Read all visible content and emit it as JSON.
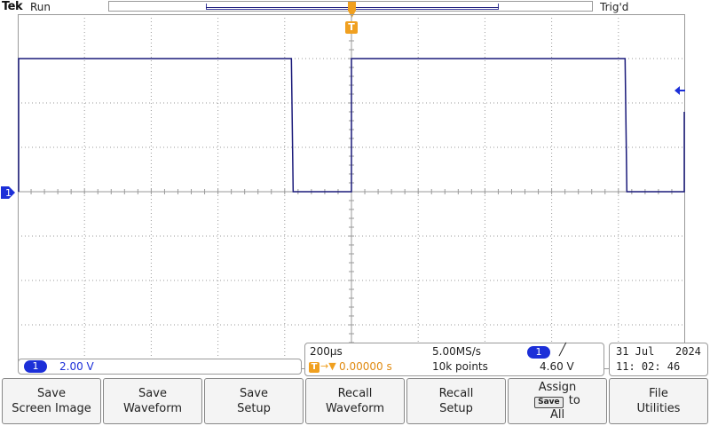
{
  "header": {
    "brand": "Tek",
    "run_state": "Run",
    "trigger_status": "Trig'd"
  },
  "markers": {
    "trigger_position_label": "T",
    "ch1_ground_label": "1"
  },
  "channel1": {
    "number": "1",
    "scale": "2.00 V",
    "color": "#1c2fd8"
  },
  "horizontal": {
    "timebase": "200μs",
    "sample_rate": "5.00MS/s",
    "trigger_source": "1",
    "trigger_slope": "╱",
    "delay_T": "T",
    "delay_arrow": "→▼",
    "delay": "0.00000 s",
    "record_length": "10k points",
    "trigger_level": "4.60 V"
  },
  "datetime": {
    "day_month": "31 Jul",
    "year": "2024",
    "time": "11: 02: 46"
  },
  "softkeys": {
    "save_screen_image": {
      "line1": "Save",
      "line2": "Screen Image"
    },
    "save_waveform": {
      "line1": "Save",
      "line2": "Waveform"
    },
    "save_setup": {
      "line1": "Save",
      "line2": "Setup"
    },
    "recall_waveform": {
      "line1": "Recall",
      "line2": "Waveform"
    },
    "recall_setup": {
      "line1": "Recall",
      "line2": "Setup"
    },
    "assign_save": {
      "line1": "Assign",
      "badge": "Save",
      "line2b": "to",
      "line3": "All"
    },
    "file_utilities": {
      "line1": "File",
      "line2": "Utilities"
    }
  },
  "colors": {
    "trace": "#1a1a7a",
    "trigger_marker": "#f0a020",
    "graticule": "#9a9a9a"
  },
  "waveform": {
    "type": "square",
    "high_divisions": 3.0,
    "low_divisions": 0.0,
    "pulse_edges_divisions": [
      0.0,
      4.1,
      5.0,
      9.1,
      10.0
    ]
  }
}
